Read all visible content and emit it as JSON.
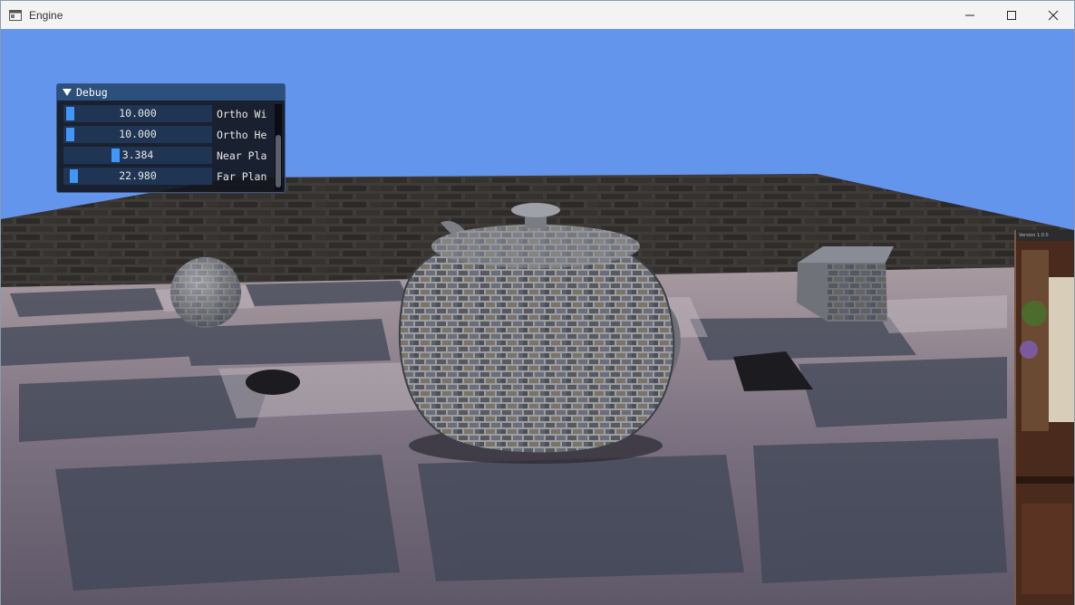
{
  "window": {
    "title": "Engine",
    "icons": {
      "app": "app-window-icon",
      "minimize": "minimize-icon",
      "maximize": "maximize-icon",
      "close": "close-icon"
    }
  },
  "colors": {
    "sky": "#6495ed",
    "imgui_title": "#2d4f7c",
    "imgui_frame": "#1f3553",
    "imgui_grab": "#4296fa"
  },
  "debug_panel": {
    "title": "Debug",
    "sliders": [
      {
        "value": "10.000",
        "label": "Ortho Wi",
        "position": 0.02
      },
      {
        "value": "10.000",
        "label": "Ortho He",
        "position": 0.02
      },
      {
        "value": "3.384",
        "label": "Near Pla",
        "position": 0.34
      },
      {
        "value": "22.980",
        "label": "Far Plan",
        "position": 0.05
      }
    ]
  },
  "side_window": {
    "title": "Version 1.0.0"
  }
}
